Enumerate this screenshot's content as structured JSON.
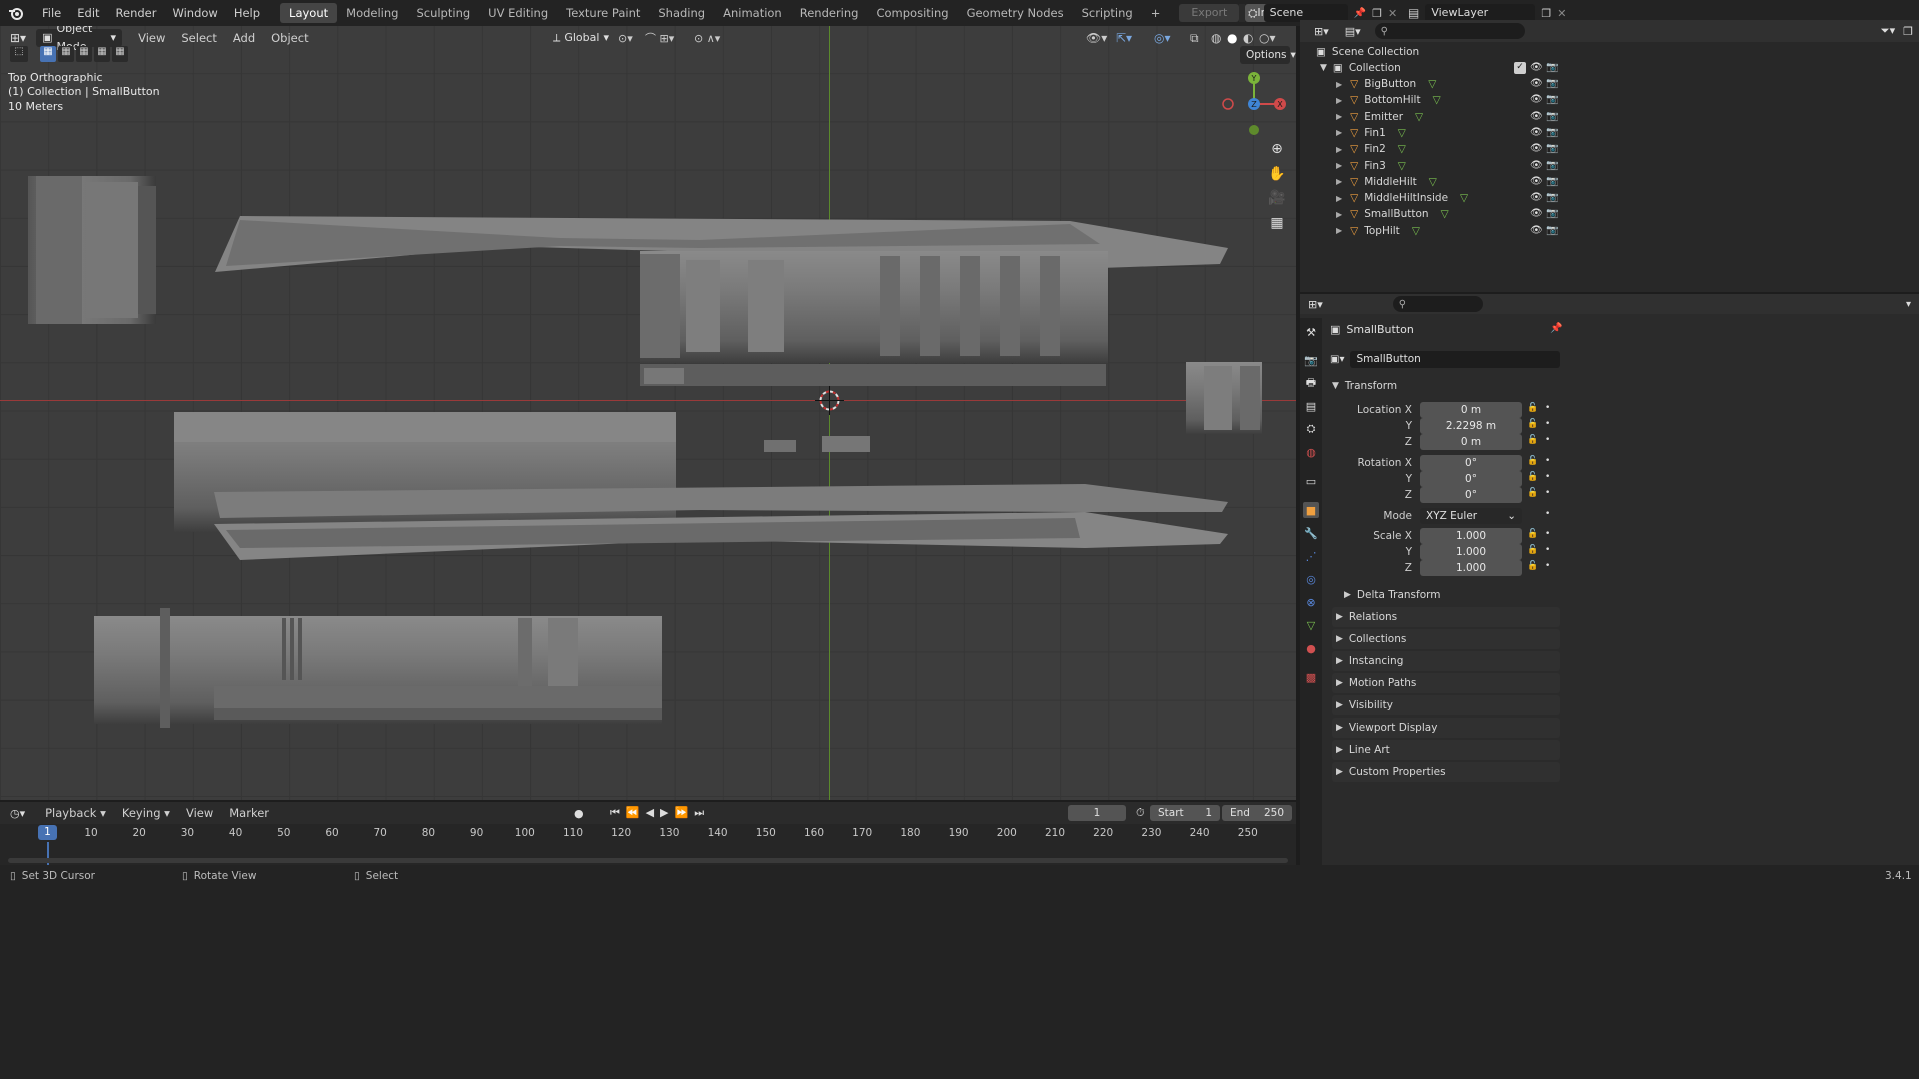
{
  "menu": {
    "items": [
      "File",
      "Edit",
      "Render",
      "Window",
      "Help"
    ]
  },
  "workspaces": {
    "tabs": [
      "Layout",
      "Modeling",
      "Sculpting",
      "UV Editing",
      "Texture Paint",
      "Shading",
      "Animation",
      "Rendering",
      "Compositing",
      "Geometry Nodes",
      "Scripting"
    ],
    "active": "Layout",
    "add_label": "+"
  },
  "toolbar": {
    "export_label": "Export",
    "import_label": "Import",
    "scene_name": "Scene",
    "view_layer_name": "ViewLayer"
  },
  "viewport": {
    "mode": "Object Mode",
    "menus": [
      "View",
      "Select",
      "Add",
      "Object"
    ],
    "orientation": "Global",
    "options_label": "Options",
    "info_view": "Top Orthographic",
    "info_collection": "(1) Collection | SmallButton",
    "info_scale": "10 Meters",
    "gizmo_axes": {
      "x": "X",
      "y": "Y",
      "z": "Z"
    },
    "colors": {
      "x_axis": "#9a3a3a",
      "y_axis": "#5b8a2c",
      "background": "#3d3d3d"
    }
  },
  "outliner": {
    "root": "Scene Collection",
    "collection": "Collection",
    "objects": [
      "BigButton",
      "BottomHilt",
      "Emitter",
      "Fin1",
      "Fin2",
      "Fin3",
      "MiddleHilt",
      "MiddleHiltInside",
      "SmallButton",
      "TopHilt"
    ]
  },
  "properties": {
    "object_name": "SmallButton",
    "data_name": "SmallButton",
    "transform_label": "Transform",
    "location_label": "Location X",
    "rotation_label": "Rotation X",
    "scale_label": "Scale X",
    "y_label": "Y",
    "z_label": "Z",
    "location": {
      "x": "0 m",
      "y": "2.2298 m",
      "z": "0 m"
    },
    "rotation": {
      "x": "0°",
      "y": "0°",
      "z": "0°"
    },
    "mode_label": "Mode",
    "mode_value": "XYZ Euler",
    "scale": {
      "x": "1.000",
      "y": "1.000",
      "z": "1.000"
    },
    "delta_transform": "Delta Transform",
    "sections": [
      "Relations",
      "Collections",
      "Instancing",
      "Motion Paths",
      "Visibility",
      "Viewport Display",
      "Line Art",
      "Custom Properties"
    ]
  },
  "timeline": {
    "menus": [
      "Playback",
      "Keying",
      "View",
      "Marker"
    ],
    "current_frame": "1",
    "current_frame_marker": "1",
    "start_label": "Start",
    "start_value": "1",
    "end_label": "End",
    "end_value": "250",
    "ruler": [
      "10",
      "20",
      "30",
      "40",
      "50",
      "60",
      "70",
      "80",
      "90",
      "100",
      "110",
      "120",
      "130",
      "140",
      "150",
      "160",
      "170",
      "180",
      "190",
      "200",
      "210",
      "220",
      "230",
      "240",
      "250"
    ]
  },
  "statusbar": {
    "left": "Set 3D Cursor",
    "middle": "Rotate View",
    "right": "Select",
    "version": "3.4.1"
  }
}
